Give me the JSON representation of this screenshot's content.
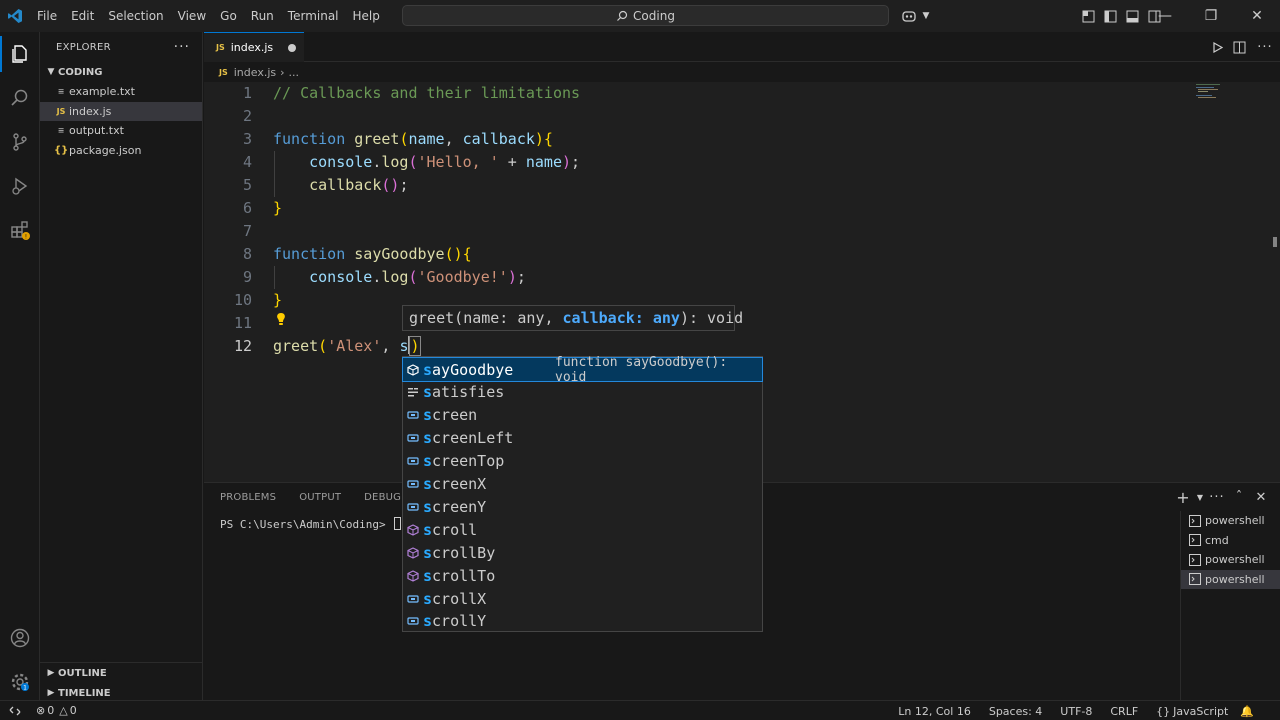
{
  "titlebar": {
    "menu": [
      "File",
      "Edit",
      "Selection",
      "View",
      "Go",
      "Run",
      "Terminal",
      "Help"
    ],
    "search_text": "Coding"
  },
  "sidebar": {
    "title": "EXPLORER",
    "folder": "CODING",
    "files": [
      {
        "name": "example.txt",
        "icon": "text-file-icon"
      },
      {
        "name": "index.js",
        "icon": "js-file-icon"
      },
      {
        "name": "output.txt",
        "icon": "text-file-icon"
      },
      {
        "name": "package.json",
        "icon": "json-file-icon"
      }
    ],
    "outline": "OUTLINE",
    "timeline": "TIMELINE"
  },
  "tab": {
    "label": "index.js",
    "badge": "JS"
  },
  "breadcrumb": {
    "file": "index.js",
    "rest": "..."
  },
  "editor": {
    "line_numbers": [
      "1",
      "2",
      "3",
      "4",
      "5",
      "6",
      "7",
      "8",
      "9",
      "10",
      "11",
      "12"
    ],
    "lines": {
      "l1": "// Callbacks and their limitations",
      "l3_kw": "function",
      "l3_fn": "greet",
      "l3_p1": "name",
      "l3_p2": "callback",
      "l4_obj": "console",
      "l4_m": "log",
      "l4_str": "'Hello, '",
      "l4_op": " + ",
      "l4_p": "name",
      "l5_fn": "callback",
      "l8_kw": "function",
      "l8_fn": "sayGoodbye",
      "l9_obj": "console",
      "l9_m": "log",
      "l9_str": "'Goodbye!'",
      "l12_fn": "greet",
      "l12_str": "'Alex'",
      "l12_typed": "s"
    }
  },
  "signature_hint": {
    "fn": "greet",
    "p1": "name: any",
    "p2": "callback: any",
    "ret": "void"
  },
  "suggestions": [
    {
      "hl": "s",
      "rest": "ayGoodbye",
      "detail": "function sayGoodbye(): void",
      "kind": "method-icon"
    },
    {
      "hl": "s",
      "rest": "atisfies",
      "kind": "keyword-icon"
    },
    {
      "hl": "s",
      "rest": "creen",
      "kind": "variable-icon"
    },
    {
      "hl": "s",
      "rest": "creenLeft",
      "kind": "variable-icon"
    },
    {
      "hl": "s",
      "rest": "creenTop",
      "kind": "variable-icon"
    },
    {
      "hl": "s",
      "rest": "creenX",
      "kind": "variable-icon"
    },
    {
      "hl": "s",
      "rest": "creenY",
      "kind": "variable-icon"
    },
    {
      "hl": "s",
      "rest": "croll",
      "kind": "method-icon"
    },
    {
      "hl": "s",
      "rest": "crollBy",
      "kind": "method-icon"
    },
    {
      "hl": "s",
      "rest": "crollTo",
      "kind": "method-icon"
    },
    {
      "hl": "s",
      "rest": "crollX",
      "kind": "variable-icon"
    },
    {
      "hl": "s",
      "rest": "crollY",
      "kind": "variable-icon"
    }
  ],
  "panel": {
    "tabs": [
      "PROBLEMS",
      "OUTPUT",
      "DEBUG CONSOLE"
    ],
    "prompt": "PS C:\\Users\\Admin\\Coding> ",
    "terminals": [
      "powershell",
      "cmd",
      "powershell",
      "powershell"
    ]
  },
  "statusbar": {
    "errors": "0",
    "warnings": "0",
    "position": "Ln 12, Col 16",
    "spaces": "Spaces: 4",
    "encoding": "UTF-8",
    "eol": "CRLF",
    "language": "JavaScript"
  },
  "colors": {
    "accent": "#0078d4",
    "selection": "#04395e",
    "highlight": "#2aaaff"
  }
}
